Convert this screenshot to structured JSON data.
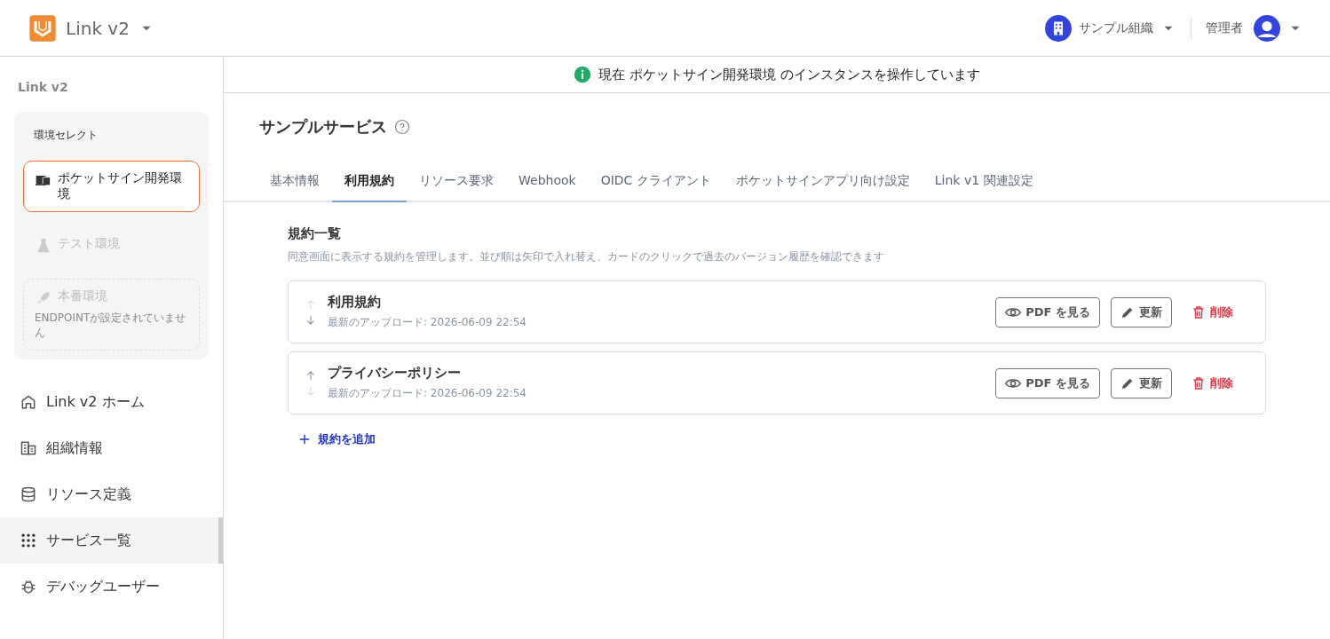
{
  "header": {
    "app_name": "Link v2",
    "organization": "サンプル組織",
    "role": "管理者"
  },
  "sidebar": {
    "title": "Link v2",
    "env_select": {
      "title": "環境セレクト",
      "items": [
        {
          "kind": "normal",
          "label": "ポケットサイン開発環境",
          "selected": true,
          "disabled": false
        },
        {
          "kind": "normal",
          "label": "テスト環境",
          "selected": false,
          "disabled": true
        },
        {
          "kind": "unset",
          "label": "本番環境",
          "note": "ENDPOINTが設定されていません",
          "selected": false,
          "disabled": true
        }
      ]
    },
    "nav": [
      {
        "label": "Link v2 ホーム",
        "selected": false
      },
      {
        "label": "組織情報",
        "selected": false
      },
      {
        "label": "リソース定義",
        "selected": false
      },
      {
        "label": "サービス一覧",
        "selected": true
      },
      {
        "label": "デバッグユーザー",
        "selected": false
      }
    ]
  },
  "banner": {
    "text": "現在 ポケットサイン開発環境 のインスタンスを操作しています"
  },
  "page": {
    "title": "サンプルサービス",
    "tabs": [
      {
        "label": "基本情報",
        "selected": false
      },
      {
        "label": "利用規約",
        "selected": true
      },
      {
        "label": "リソース要求",
        "selected": false
      },
      {
        "label": "Webhook",
        "selected": false
      },
      {
        "label": "OIDC クライアント",
        "selected": false
      },
      {
        "label": "ポケットサインアプリ向け設定",
        "selected": false
      },
      {
        "label": "Link v1 関連設定",
        "selected": false
      }
    ],
    "section": {
      "title": "規約一覧",
      "description": "同意画面に表示する規約を管理します。並び順は矢印で入れ替え、カードのクリックで過去のバージョン履歴を確認できます",
      "terms": [
        {
          "name": "利用規約",
          "uploaded": "最新のアップロード: 2026-06-09 22:54",
          "up_disabled": true,
          "down_disabled": false,
          "view_label": "PDF を見る",
          "update_label": "更新",
          "delete_label": "削除"
        },
        {
          "name": "プライバシーポリシー",
          "uploaded": "最新のアップロード: 2026-06-09 22:54",
          "up_disabled": false,
          "down_disabled": true,
          "view_label": "PDF を見る",
          "update_label": "更新",
          "delete_label": "削除"
        }
      ],
      "add_label": "規約を追加"
    }
  }
}
